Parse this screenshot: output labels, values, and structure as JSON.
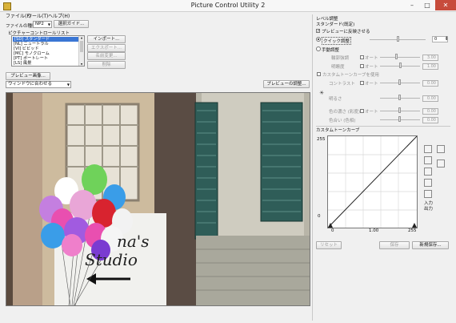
{
  "window": {
    "title": "Picture Control Utility 2"
  },
  "menu": [
    {
      "label": "ファイル(F)"
    },
    {
      "label": "ツール(T)"
    },
    {
      "label": "ヘルプ(H)"
    }
  ],
  "left": {
    "file_type_label": "ファイルの種類:",
    "file_type_value": "NP2",
    "guide_button": "選択ガイド...",
    "list_label": "ピクチャーコントロールリスト",
    "list_items": [
      "[SD] スタンダード",
      "[NL] ニュートラル",
      "[VI] ビビッド",
      "[MC] モノクローム",
      "[PT] ポートレート",
      "[LS] 風景"
    ],
    "buttons": {
      "import": "インポート...",
      "export": "エクスポート...",
      "rename": "名前変更...",
      "delete": "削除"
    },
    "preview_image_button": "プレビュー画像...",
    "zoom_value": "ウィンドウに合わせる",
    "preview_adjust_button": "プレビューの調整..."
  },
  "photo": {
    "sign_text_1": "na's",
    "sign_text_2": "Studio"
  },
  "right": {
    "header": "レベル調整",
    "subheader": "スタンダード(既定)",
    "apply_preview": "プレビューに反映させる",
    "quick": {
      "label": "クイック調整",
      "value": "0"
    },
    "manual": {
      "label": "手動調整"
    },
    "sharpening": {
      "label": "輪郭強調",
      "auto": "オート",
      "value": "3.00"
    },
    "clarity": {
      "label": "明瞭度",
      "auto": "オート",
      "value": "1.00"
    },
    "custom_curve": {
      "label": "カスタムトーンカーブを使用"
    },
    "contrast": {
      "label": "コントラスト",
      "auto": "オート",
      "value": "0.00"
    },
    "brightness": {
      "label": "明るさ",
      "value": "0.00"
    },
    "saturation": {
      "label": "色の濃さ (彩度)",
      "auto": "オート",
      "value": "0.00"
    },
    "hue": {
      "label": "色合い (色相)",
      "value": "0.00"
    },
    "curve_title": "カスタムトーンカーブ",
    "curve": {
      "y_top": "255",
      "y_bottom": "0",
      "x_left": "0",
      "x_mid": "1.00",
      "x_right": "255",
      "io_in": "入力",
      "io_out": "出力"
    },
    "buttons": {
      "reset": "リセット",
      "save": "保存",
      "save_new": "新規保存..."
    }
  },
  "colors": {
    "accent": "#3a76d4",
    "balloon_pink": "#e94fb0",
    "balloon_blue": "#3a9de8",
    "balloon_green": "#6fd25a",
    "balloon_red": "#d8232f",
    "shutter": "#2f5d58"
  }
}
